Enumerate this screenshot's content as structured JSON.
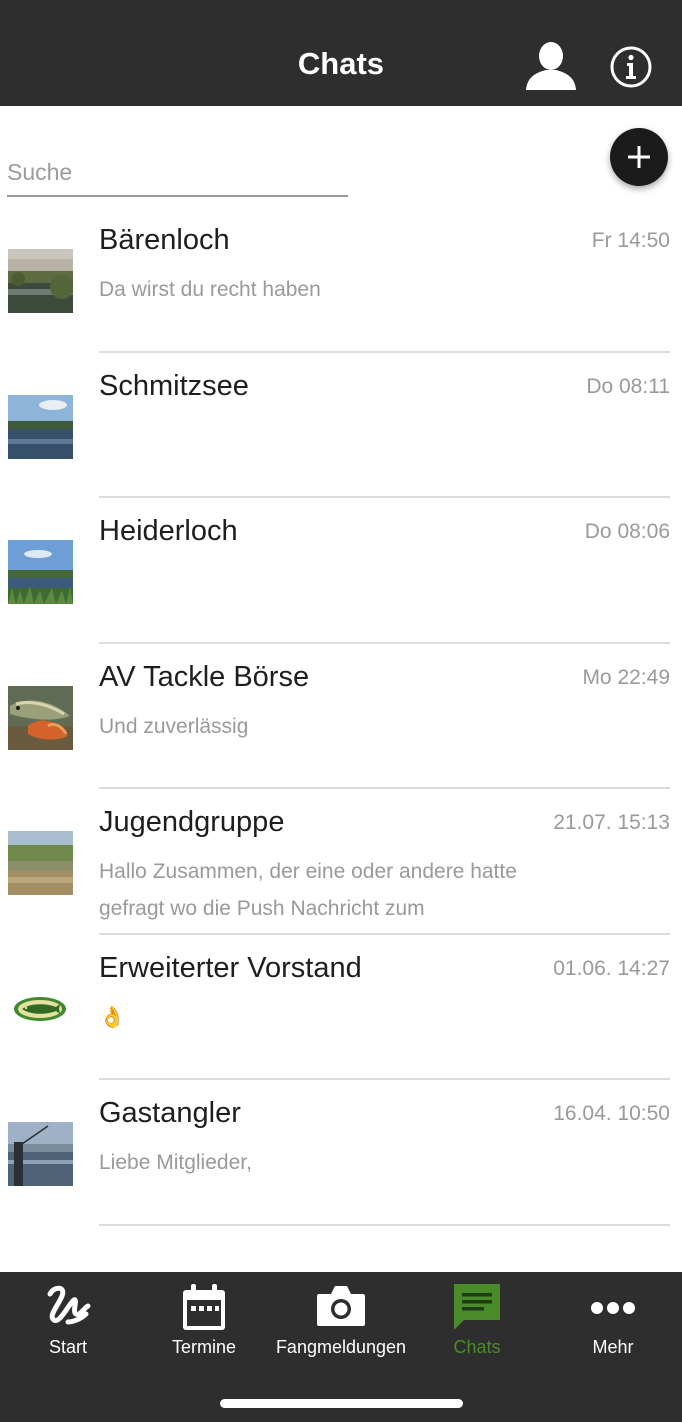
{
  "header": {
    "title": "Chats"
  },
  "search": {
    "placeholder": "Suche"
  },
  "chats": [
    {
      "name": "Bärenloch",
      "time": "Fr 14:50",
      "preview": "Da wirst du recht haben"
    },
    {
      "name": "Schmitzsee",
      "time": "Do 08:11",
      "preview": ""
    },
    {
      "name": "Heiderloch",
      "time": "Do 08:06",
      "preview": ""
    },
    {
      "name": "AV Tackle Börse",
      "time": "Mo 22:49",
      "preview": "Und zuverlässig"
    },
    {
      "name": "Jugendgruppe",
      "time": "21.07. 15:13",
      "preview": "Hallo Zusammen,  der eine oder andere hatte gefragt wo die Push Nachricht zum"
    },
    {
      "name": "Erweiterter Vorstand",
      "time": "01.06. 14:27",
      "preview": "👌"
    },
    {
      "name": "Gastangler",
      "time": "16.04. 10:50",
      "preview": "Liebe Mitglieder,"
    }
  ],
  "tabs": [
    {
      "label": "Start",
      "icon": "start-icon"
    },
    {
      "label": "Termine",
      "icon": "calendar-icon"
    },
    {
      "label": "Fangmeldungen",
      "icon": "camera-icon"
    },
    {
      "label": "Chats",
      "icon": "chat-icon"
    },
    {
      "label": "Mehr",
      "icon": "more-icon"
    }
  ],
  "colors": {
    "bar": "#2e2e2e",
    "accent": "#4a8c2a",
    "fab": "#1b1b1b"
  }
}
